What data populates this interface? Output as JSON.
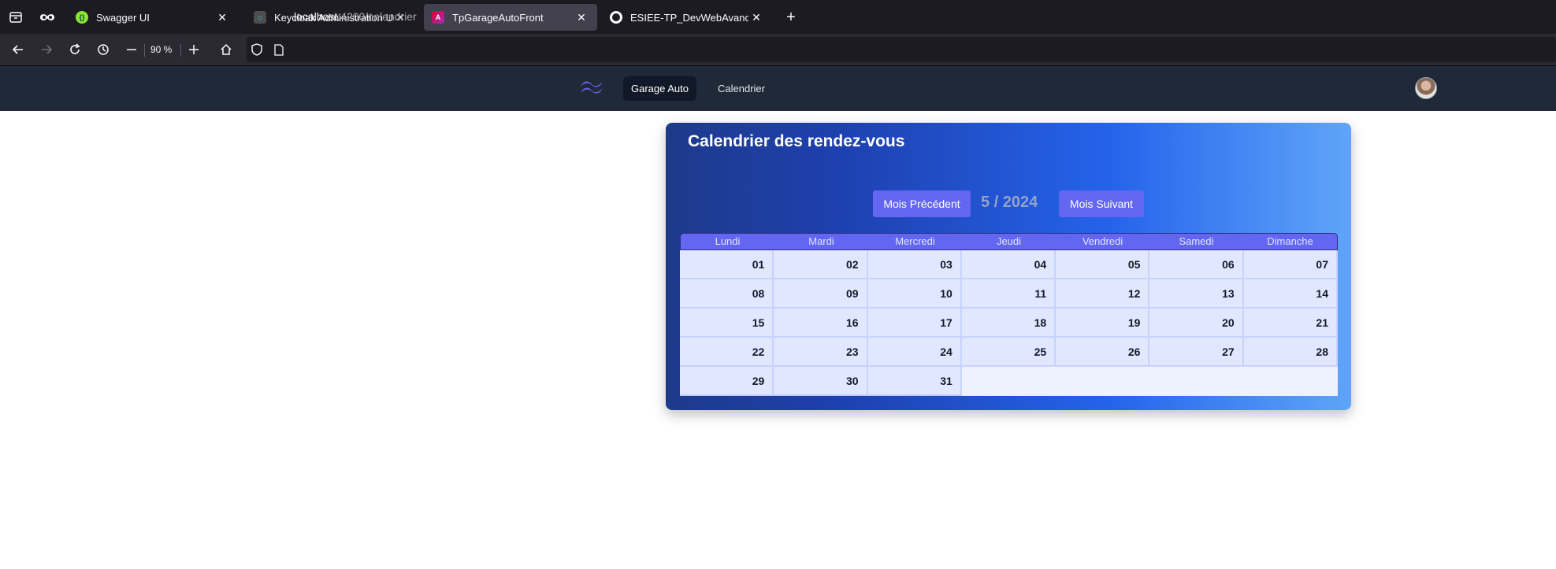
{
  "browser": {
    "tabs": [
      {
        "title": "Swagger UI",
        "active": false,
        "favicon": "swagger-icon"
      },
      {
        "title": "Keycloak Administration UI",
        "active": false,
        "favicon": "keycloak-icon"
      },
      {
        "title": "TpGarageAutoFront",
        "active": true,
        "favicon": "angular-icon"
      },
      {
        "title": "ESIEE-TP_DevWebAvance/front",
        "active": false,
        "favicon": "github-icon"
      }
    ],
    "zoom": "90 %",
    "url_host": "localhost",
    "url_path": ":4200/calendrier"
  },
  "app": {
    "nav": {
      "brand_label": "Garage Auto",
      "calendar_label": "Calendrier"
    }
  },
  "calendar": {
    "title": "Calendrier des rendez-vous",
    "prev_label": "Mois Précédent",
    "next_label": "Mois Suivant",
    "month_label": "5 / 2024",
    "weekdays": [
      "Lundi",
      "Mardi",
      "Mercredi",
      "Jeudi",
      "Vendredi",
      "Samedi",
      "Dimanche"
    ],
    "days": [
      "01",
      "02",
      "03",
      "04",
      "05",
      "06",
      "07",
      "08",
      "09",
      "10",
      "11",
      "12",
      "13",
      "14",
      "15",
      "16",
      "17",
      "18",
      "19",
      "20",
      "21",
      "22",
      "23",
      "24",
      "25",
      "26",
      "27",
      "28",
      "29",
      "30",
      "31"
    ],
    "trailing_empty_cells": 4
  },
  "colors": {
    "header_bg": "#1f2937",
    "accent": "#6366f1",
    "card_gradient_start": "#1e3a8a",
    "card_gradient_end": "#60a5fa"
  }
}
